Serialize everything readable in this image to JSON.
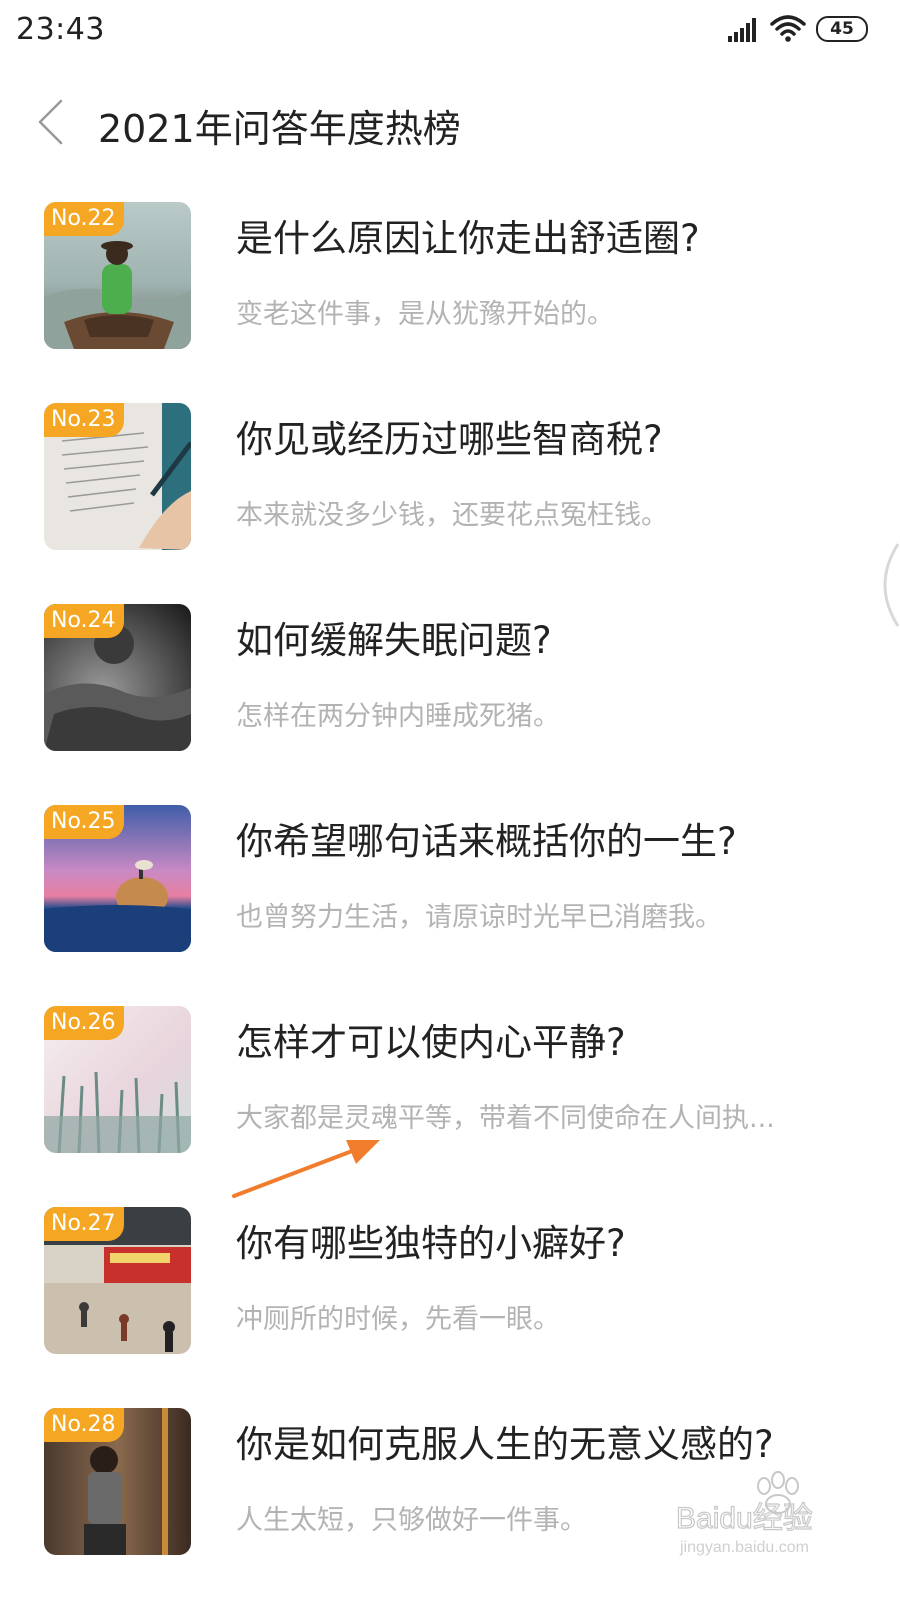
{
  "status_bar": {
    "time": "23:43",
    "battery": "45",
    "icons": [
      "signal-icon",
      "wifi-icon",
      "battery-icon"
    ]
  },
  "header": {
    "back_icon": "chevron-left-icon",
    "title": "2021年问答年度热榜"
  },
  "items": [
    {
      "rank": "No.22",
      "title": "是什么原因让你走出舒适圈?",
      "subtitle": "变老这件事，是从犹豫开始的。"
    },
    {
      "rank": "No.23",
      "title": "你见或经历过哪些智商税?",
      "subtitle": "本来就没多少钱，还要花点冤枉钱。"
    },
    {
      "rank": "No.24",
      "title": "如何缓解失眠问题?",
      "subtitle": "怎样在两分钟内睡成死猪。"
    },
    {
      "rank": "No.25",
      "title": "你希望哪句话来概括你的一生?",
      "subtitle": "也曾努力生活，请原谅时光早已消磨我。"
    },
    {
      "rank": "No.26",
      "title": "怎样才可以使内心平静?",
      "subtitle": "大家都是灵魂平等，带着不同使命在人间执..."
    },
    {
      "rank": "No.27",
      "title": "你有哪些独特的小癖好?",
      "subtitle": "冲厕所的时候，先看一眼。"
    },
    {
      "rank": "No.28",
      "title": "你是如何克服人生的无意义感的?",
      "subtitle": "人生太短，只够做好一件事。"
    }
  ],
  "annotation": {
    "color": "#f07c2c"
  },
  "watermark": {
    "brand": "Baidu经验",
    "url": "jingyan.baidu.com"
  },
  "colors": {
    "badge": "#f5a623",
    "title_text": "#222222",
    "subtitle_text": "#b3b3b3"
  }
}
